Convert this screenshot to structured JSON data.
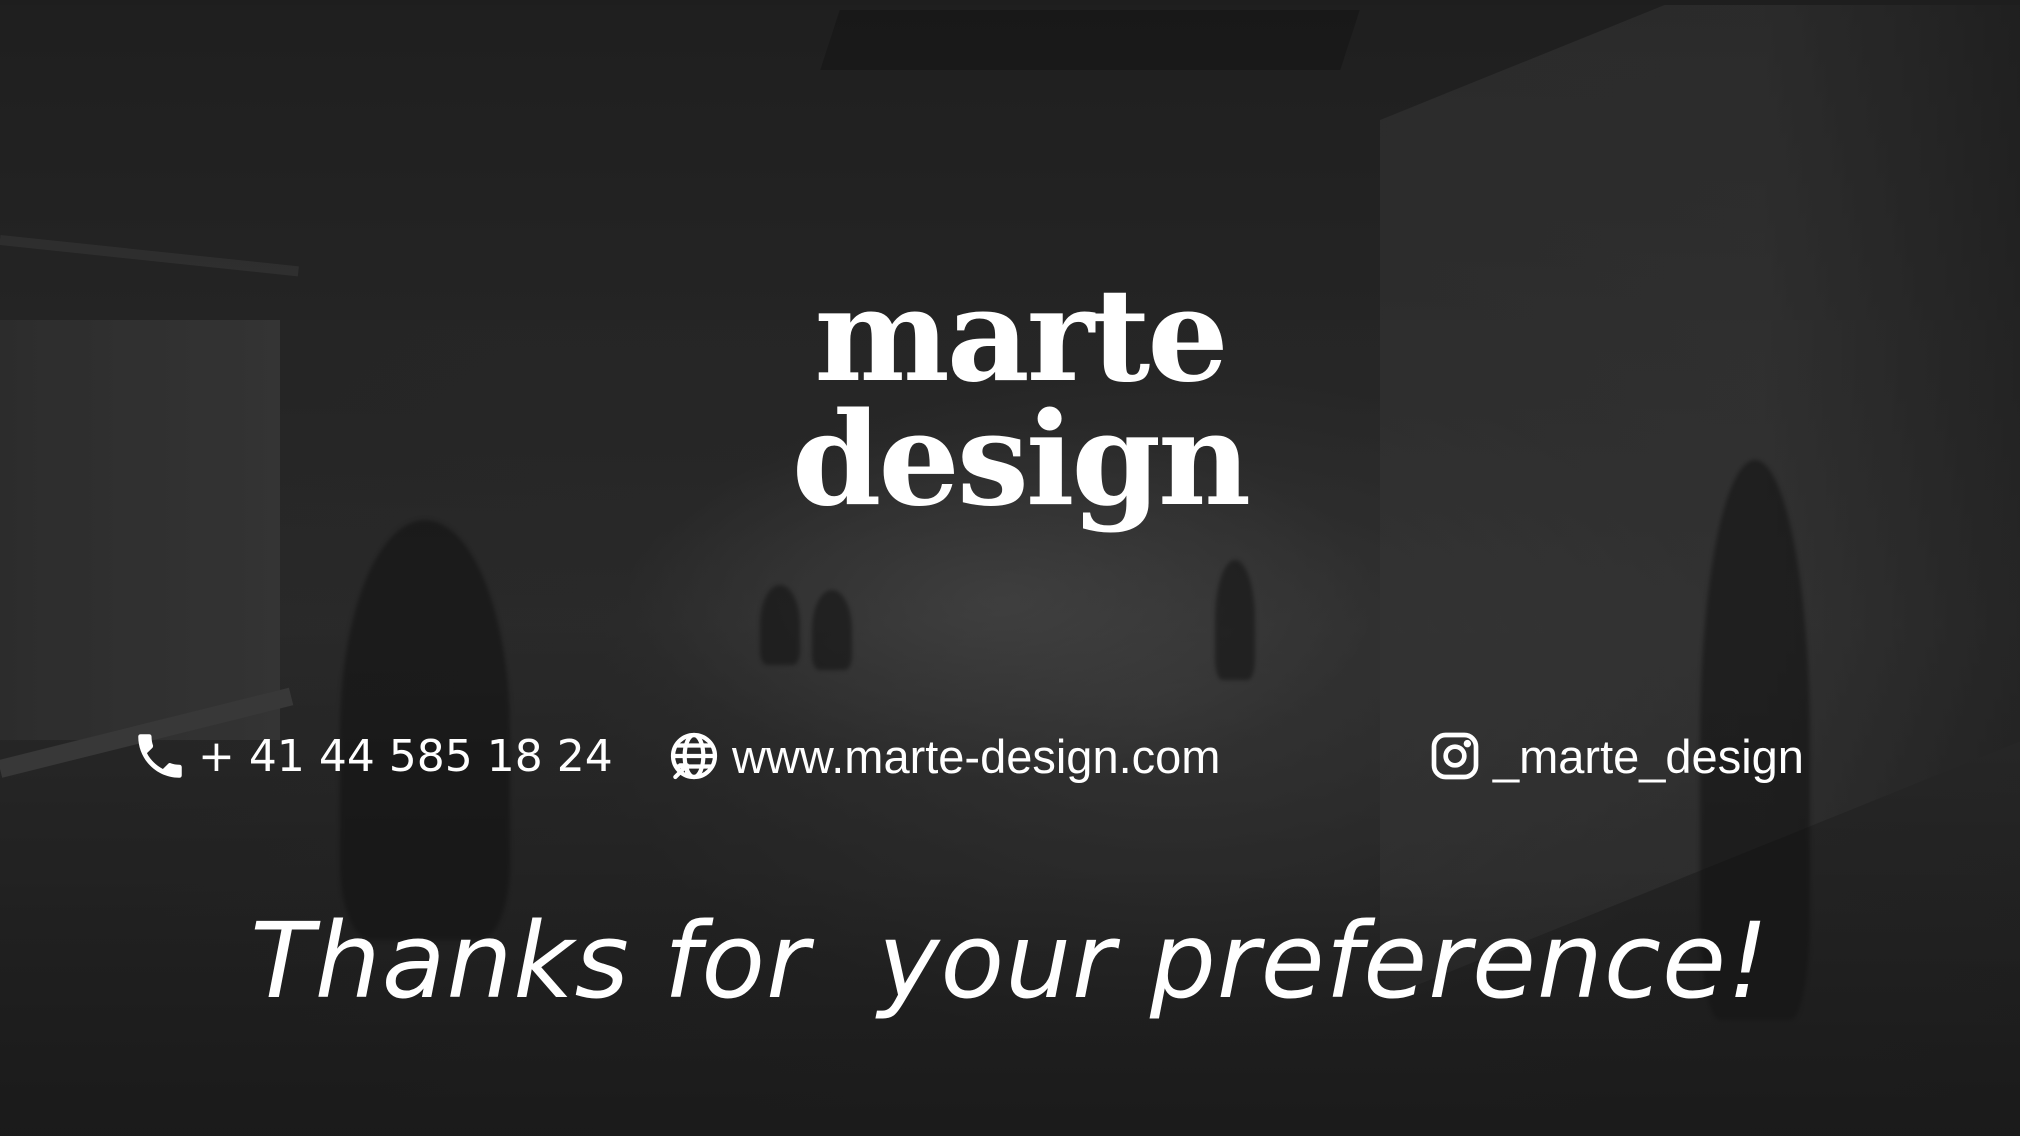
{
  "brand": {
    "logo_line_1": "marte",
    "logo_line_2": "design"
  },
  "contacts": {
    "phone": {
      "icon": "phone-icon",
      "text": "+ 41 44 585 18 24"
    },
    "website": {
      "icon": "globe-icon",
      "text": "www.marte-design.com"
    },
    "instagram": {
      "icon": "instagram-icon",
      "text": "_marte_design"
    }
  },
  "closing": {
    "message": "Thanks for  your preference!"
  },
  "colors": {
    "text": "#ffffff",
    "background": "#2e2e2e"
  }
}
